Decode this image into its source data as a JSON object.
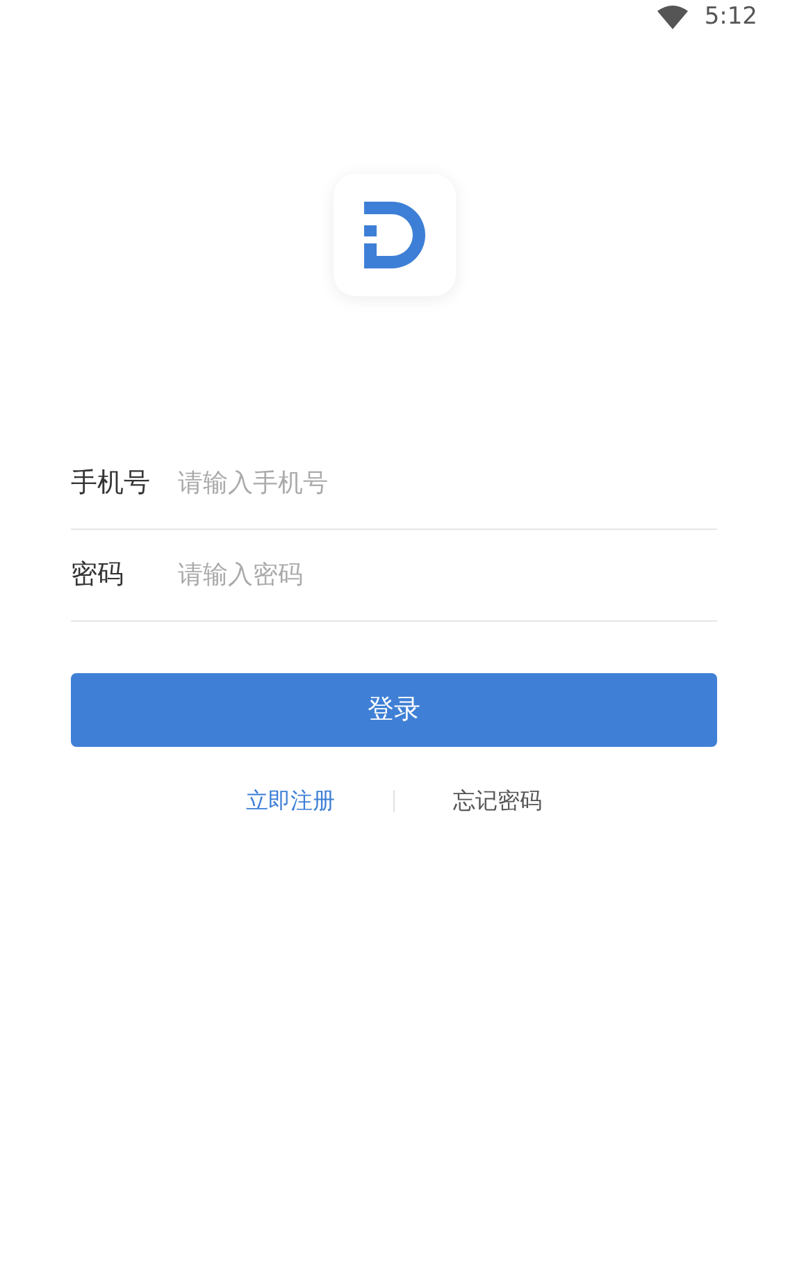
{
  "status_bar": {
    "time": "5:12"
  },
  "form": {
    "fields": [
      {
        "label": "手机号",
        "placeholder": "请输入手机号"
      },
      {
        "label": "密码",
        "placeholder": "请输入密码"
      }
    ]
  },
  "login_button": "登录",
  "links": [
    {
      "label": "立即注册",
      "kind": "primary"
    },
    {
      "label": "忘记密码",
      "kind": "plain"
    }
  ]
}
